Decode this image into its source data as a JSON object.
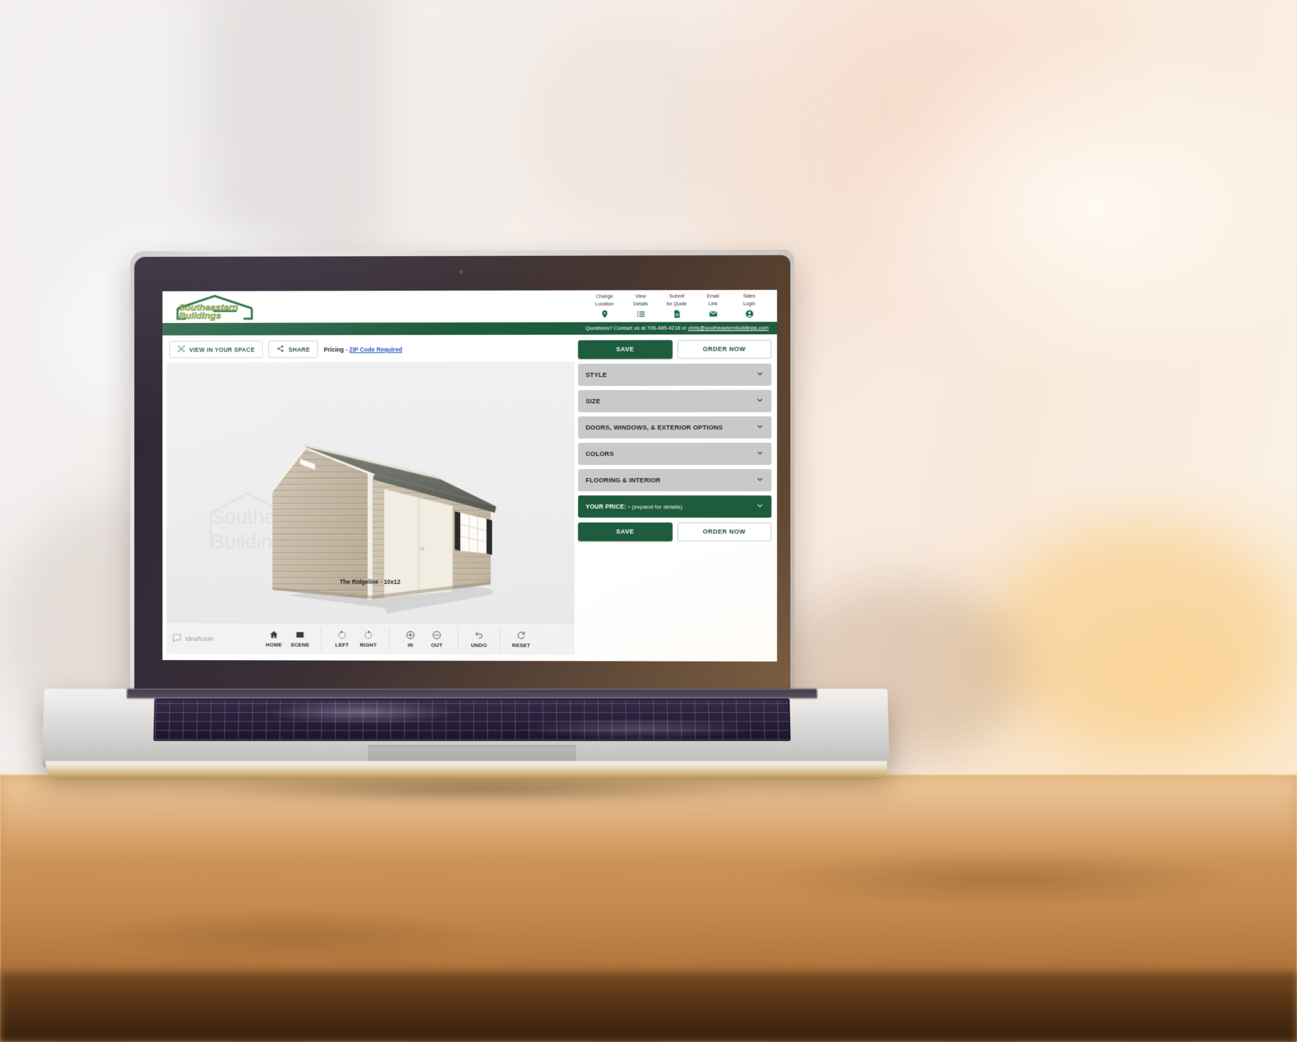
{
  "app": {
    "brand": {
      "logo_line1": "Southeastern",
      "logo_line2": "Buildings",
      "logo_text_color": "#d8c832",
      "logo_frame_color": "#17663c"
    },
    "nav": [
      {
        "label_line1": "Change",
        "label_line2": "Location",
        "icon": "map-pin-icon"
      },
      {
        "label_line1": "View",
        "label_line2": "Details",
        "icon": "list-icon"
      },
      {
        "label_line1": "Submit",
        "label_line2": "for Quote",
        "icon": "document-icon"
      },
      {
        "label_line1": "Email",
        "label_line2": "Link",
        "icon": "envelope-icon"
      },
      {
        "label_line1": "Sales",
        "label_line2": "Login",
        "icon": "account-icon"
      }
    ],
    "contact_bar": {
      "text": "Questions? Contact us at 706-485-4218 or ",
      "email": "chris@southeasternbuildings.com",
      "bg_color": "#1d5c3c"
    },
    "viewer_toolbar_top": {
      "view_in_space_label": "VIEW IN YOUR SPACE",
      "view_in_space_icon": "ar-cube-icon",
      "share_label": "SHARE",
      "share_icon": "share-icon",
      "pricing_prefix": "Pricing - ",
      "pricing_link": "ZIP Code Required"
    },
    "viewer": {
      "model_label": "The Ridgeline - 10x12",
      "watermark_line1": "Southeastern",
      "watermark_line2": "Buildings",
      "building": {
        "siding_color": "#c6b9a6",
        "siding_shadow_color": "#ab9d89",
        "trim_color": "#f3efe6",
        "roof_color": "#787c74",
        "roof_shadow_color": "#5e635c",
        "door_color": "#f0ece1",
        "shutter_color": "#2a2a2a",
        "ground_color": "#e0e0e0"
      }
    },
    "viewer_toolbar_bottom": {
      "watermark_brand": "IdeaRoom",
      "groups": [
        {
          "items": [
            {
              "label": "HOME",
              "icon": "home-icon"
            },
            {
              "label": "SCENE",
              "icon": "scene-image-icon"
            }
          ]
        },
        {
          "items": [
            {
              "label": "LEFT",
              "icon": "rotate-left-icon"
            },
            {
              "label": "RIGHT",
              "icon": "rotate-right-icon"
            }
          ]
        },
        {
          "items": [
            {
              "label": "IN",
              "icon": "zoom-in-icon"
            },
            {
              "label": "OUT",
              "icon": "zoom-out-icon"
            }
          ]
        },
        {
          "items": [
            {
              "label": "UNDO",
              "icon": "undo-icon"
            }
          ]
        },
        {
          "items": [
            {
              "label": "RESET",
              "icon": "reset-icon"
            }
          ]
        }
      ]
    },
    "options_panel": {
      "save_label": "SAVE",
      "order_label": "ORDER NOW",
      "sections": [
        {
          "label": "STYLE"
        },
        {
          "label": "SIZE"
        },
        {
          "label": "DOORS, WINDOWS, & EXTERIOR OPTIONS"
        },
        {
          "label": "COLORS"
        },
        {
          "label": "FLOORING & INTERIOR"
        }
      ],
      "price_section": {
        "label": "YOUR PRICE:",
        "value": " - ",
        "hint": "(expand for details)"
      }
    }
  }
}
